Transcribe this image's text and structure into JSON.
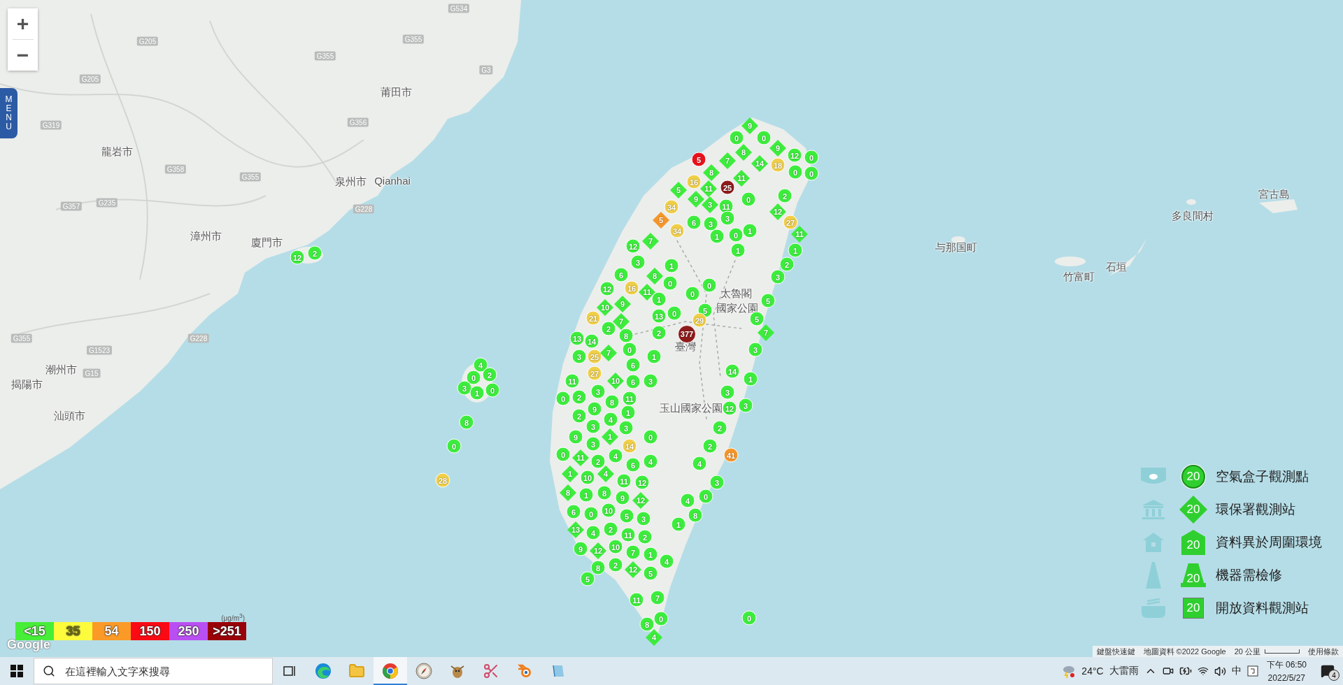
{
  "map_controls": {
    "zoom_in": "+",
    "zoom_out": "−"
  },
  "menu_tab": "MENU",
  "place_labels": [
    {
      "text": "莆田市"
    },
    {
      "text": "龍岩市"
    },
    {
      "text": "泉州市"
    },
    {
      "text": "漳州市"
    },
    {
      "text": "廈門市"
    },
    {
      "text": "潮州市"
    },
    {
      "text": "揭陽市"
    },
    {
      "text": "汕頭市"
    },
    {
      "text": "Qianhai"
    },
    {
      "text": "与那国町"
    },
    {
      "text": "多良間村"
    },
    {
      "text": "宮古島"
    },
    {
      "text": "竹富町"
    },
    {
      "text": "石垣"
    },
    {
      "text": "太魯閣"
    },
    {
      "text": "國家公園"
    },
    {
      "text": "玉山國家公園"
    },
    {
      "text": "臺灣"
    }
  ],
  "road_shields": [
    "G534",
    "G205",
    "G205",
    "G355",
    "G355",
    "G3",
    "G356",
    "G319",
    "G358",
    "G355",
    "G228",
    "G235",
    "G357",
    "G1523",
    "G15",
    "G228",
    "G355"
  ],
  "stations": [
    {
      "kind": "diamond",
      "value": "9",
      "color": "#3ded3d"
    },
    {
      "kind": "circle",
      "value": "0",
      "color": "#3ded3d"
    },
    {
      "kind": "circle",
      "value": "0",
      "color": "#3ded3d"
    },
    {
      "kind": "diamond",
      "value": "8",
      "color": "#3ded3d"
    },
    {
      "kind": "diamond",
      "value": "9",
      "color": "#3ded3d"
    },
    {
      "kind": "circle",
      "value": "12",
      "color": "#3ded3d"
    },
    {
      "kind": "circle",
      "value": "0",
      "color": "#3ded3d"
    },
    {
      "kind": "circle",
      "value": "0",
      "color": "#3ded3d"
    },
    {
      "kind": "circle",
      "value": "0",
      "color": "#3ded3d"
    },
    {
      "kind": "diamond",
      "value": "14",
      "color": "#3ded3d"
    },
    {
      "kind": "diamond",
      "value": "7",
      "color": "#3ded3d"
    },
    {
      "kind": "circle",
      "value": "18",
      "color": "#f0cf48"
    },
    {
      "kind": "circle",
      "value": "5",
      "color": "#e8121c"
    },
    {
      "kind": "diamond",
      "value": "8",
      "color": "#3ded3d"
    },
    {
      "kind": "diamond",
      "value": "11",
      "color": "#3ded3d"
    },
    {
      "kind": "diamond",
      "value": "11",
      "color": "#3ded3d"
    },
    {
      "kind": "circle",
      "value": "25",
      "color": "#8e1b1b"
    },
    {
      "kind": "circle",
      "value": "16",
      "color": "#f0cf48"
    },
    {
      "kind": "diamond",
      "value": "5",
      "color": "#3ded3d"
    },
    {
      "kind": "circle",
      "value": "34",
      "color": "#f0cf48"
    },
    {
      "kind": "diamond",
      "value": "9",
      "color": "#3ded3d"
    },
    {
      "kind": "diamond",
      "value": "3",
      "color": "#3ded3d"
    },
    {
      "kind": "circle",
      "value": "11",
      "color": "#3ded3d"
    },
    {
      "kind": "circle",
      "value": "0",
      "color": "#3ded3d"
    },
    {
      "kind": "diamond",
      "value": "5",
      "color": "#f5962a"
    },
    {
      "kind": "circle",
      "value": "34",
      "color": "#f0cf48"
    },
    {
      "kind": "circle",
      "value": "6",
      "color": "#3ded3d"
    },
    {
      "kind": "circle",
      "value": "3",
      "color": "#3ded3d"
    },
    {
      "kind": "circle",
      "value": "3",
      "color": "#3ded3d"
    },
    {
      "kind": "circle",
      "value": "1",
      "color": "#3ded3d"
    },
    {
      "kind": "circle",
      "value": "1",
      "color": "#3ded3d"
    },
    {
      "kind": "circle",
      "value": "2",
      "color": "#3ded3d"
    },
    {
      "kind": "diamond",
      "value": "12",
      "color": "#3ded3d"
    },
    {
      "kind": "circle",
      "value": "27",
      "color": "#f0cf48"
    },
    {
      "kind": "diamond",
      "value": "11",
      "color": "#3ded3d"
    },
    {
      "kind": "circle",
      "value": "1",
      "color": "#3ded3d"
    },
    {
      "kind": "circle",
      "value": "2",
      "color": "#3ded3d"
    },
    {
      "kind": "circle",
      "value": "3",
      "color": "#3ded3d"
    },
    {
      "kind": "circle",
      "value": "0",
      "color": "#3ded3d"
    },
    {
      "kind": "circle",
      "value": "1",
      "color": "#3ded3d"
    },
    {
      "kind": "diamond",
      "value": "7",
      "color": "#3ded3d"
    },
    {
      "kind": "circle",
      "value": "12",
      "color": "#3ded3d"
    },
    {
      "kind": "circle",
      "value": "3",
      "color": "#3ded3d"
    },
    {
      "kind": "diamond",
      "value": "8",
      "color": "#3ded3d"
    },
    {
      "kind": "circle",
      "value": "1",
      "color": "#3ded3d"
    },
    {
      "kind": "circle",
      "value": "0",
      "color": "#3ded3d"
    },
    {
      "kind": "circle",
      "value": "6",
      "color": "#3ded3d"
    },
    {
      "kind": "circle",
      "value": "16",
      "color": "#f0cf48"
    },
    {
      "kind": "diamond",
      "value": "11",
      "color": "#3ded3d"
    },
    {
      "kind": "circle",
      "value": "12",
      "color": "#3ded3d"
    },
    {
      "kind": "diamond",
      "value": "9",
      "color": "#3ded3d"
    },
    {
      "kind": "diamond",
      "value": "10",
      "color": "#3ded3d"
    },
    {
      "kind": "diamond",
      "value": "7",
      "color": "#3ded3d"
    },
    {
      "kind": "circle",
      "value": "21",
      "color": "#f0cf48"
    },
    {
      "kind": "circle",
      "value": "2",
      "color": "#3ded3d"
    },
    {
      "kind": "circle",
      "value": "8",
      "color": "#3ded3d"
    },
    {
      "kind": "circle",
      "value": "1",
      "color": "#3ded3d"
    },
    {
      "kind": "circle",
      "value": "13",
      "color": "#3ded3d"
    },
    {
      "kind": "circle",
      "value": "2",
      "color": "#3ded3d"
    },
    {
      "kind": "circle",
      "value": "0",
      "color": "#3ded3d"
    },
    {
      "kind": "circle",
      "value": "0",
      "color": "#3ded3d"
    },
    {
      "kind": "circle",
      "value": "0",
      "color": "#3ded3d"
    },
    {
      "kind": "circle",
      "value": "5",
      "color": "#3ded3d"
    },
    {
      "kind": "circle",
      "value": "377",
      "color": "#8e1b1b"
    },
    {
      "kind": "circle",
      "value": "29",
      "color": "#f0cf48"
    },
    {
      "kind": "circle",
      "value": "5",
      "color": "#3ded3d"
    },
    {
      "kind": "circle",
      "value": "5",
      "color": "#3ded3d"
    },
    {
      "kind": "diamond",
      "value": "7",
      "color": "#3ded3d"
    },
    {
      "kind": "circle",
      "value": "3",
      "color": "#3ded3d"
    },
    {
      "kind": "circle",
      "value": "13",
      "color": "#3ded3d"
    },
    {
      "kind": "circle",
      "value": "14",
      "color": "#3ded3d"
    },
    {
      "kind": "circle",
      "value": "25",
      "color": "#f0cf48"
    },
    {
      "kind": "diamond",
      "value": "7",
      "color": "#3ded3d"
    },
    {
      "kind": "circle",
      "value": "3",
      "color": "#3ded3d"
    },
    {
      "kind": "circle",
      "value": "0",
      "color": "#3ded3d"
    },
    {
      "kind": "circle",
      "value": "6",
      "color": "#3ded3d"
    },
    {
      "kind": "circle",
      "value": "1",
      "color": "#3ded3d"
    },
    {
      "kind": "diamond",
      "value": "10",
      "color": "#3ded3d"
    },
    {
      "kind": "circle",
      "value": "6",
      "color": "#3ded3d"
    },
    {
      "kind": "circle",
      "value": "3",
      "color": "#3ded3d"
    },
    {
      "kind": "circle",
      "value": "27",
      "color": "#f0cf48"
    },
    {
      "kind": "circle",
      "value": "11",
      "color": "#3ded3d"
    },
    {
      "kind": "circle",
      "value": "2",
      "color": "#3ded3d"
    },
    {
      "kind": "circle",
      "value": "3",
      "color": "#3ded3d"
    },
    {
      "kind": "circle",
      "value": "0",
      "color": "#3ded3d"
    },
    {
      "kind": "circle",
      "value": "9",
      "color": "#3ded3d"
    },
    {
      "kind": "circle",
      "value": "8",
      "color": "#3ded3d"
    },
    {
      "kind": "circle",
      "value": "1",
      "color": "#3ded3d"
    },
    {
      "kind": "circle",
      "value": "4",
      "color": "#3ded3d"
    },
    {
      "kind": "circle",
      "value": "2",
      "color": "#3ded3d"
    },
    {
      "kind": "circle",
      "value": "11",
      "color": "#3ded3d"
    },
    {
      "kind": "circle",
      "value": "3",
      "color": "#3ded3d"
    },
    {
      "kind": "circle",
      "value": "9",
      "color": "#3ded3d"
    },
    {
      "kind": "circle",
      "value": "3",
      "color": "#3ded3d"
    },
    {
      "kind": "diamond",
      "value": "1",
      "color": "#3ded3d"
    },
    {
      "kind": "circle",
      "value": "3",
      "color": "#3ded3d"
    },
    {
      "kind": "circle",
      "value": "14",
      "color": "#f0cf48"
    },
    {
      "kind": "circle",
      "value": "0",
      "color": "#3ded3d"
    },
    {
      "kind": "circle",
      "value": "0",
      "color": "#3ded3d"
    },
    {
      "kind": "diamond",
      "value": "11",
      "color": "#3ded3d"
    },
    {
      "kind": "circle",
      "value": "2",
      "color": "#3ded3d"
    },
    {
      "kind": "circle",
      "value": "4",
      "color": "#3ded3d"
    },
    {
      "kind": "circle",
      "value": "6",
      "color": "#3ded3d"
    },
    {
      "kind": "circle",
      "value": "4",
      "color": "#3ded3d"
    },
    {
      "kind": "diamond",
      "value": "1",
      "color": "#3ded3d"
    },
    {
      "kind": "circle",
      "value": "10",
      "color": "#3ded3d"
    },
    {
      "kind": "diamond",
      "value": "4",
      "color": "#3ded3d"
    },
    {
      "kind": "circle",
      "value": "11",
      "color": "#3ded3d"
    },
    {
      "kind": "circle",
      "value": "12",
      "color": "#3ded3d"
    },
    {
      "kind": "diamond",
      "value": "8",
      "color": "#3ded3d"
    },
    {
      "kind": "circle",
      "value": "1",
      "color": "#3ded3d"
    },
    {
      "kind": "circle",
      "value": "8",
      "color": "#3ded3d"
    },
    {
      "kind": "circle",
      "value": "9",
      "color": "#3ded3d"
    },
    {
      "kind": "diamond",
      "value": "12",
      "color": "#3ded3d"
    },
    {
      "kind": "circle",
      "value": "6",
      "color": "#3ded3d"
    },
    {
      "kind": "circle",
      "value": "0",
      "color": "#3ded3d"
    },
    {
      "kind": "circle",
      "value": "10",
      "color": "#3ded3d"
    },
    {
      "kind": "circle",
      "value": "5",
      "color": "#3ded3d"
    },
    {
      "kind": "circle",
      "value": "3",
      "color": "#3ded3d"
    },
    {
      "kind": "diamond",
      "value": "13",
      "color": "#3ded3d"
    },
    {
      "kind": "circle",
      "value": "4",
      "color": "#3ded3d"
    },
    {
      "kind": "circle",
      "value": "2",
      "color": "#3ded3d"
    },
    {
      "kind": "circle",
      "value": "11",
      "color": "#3ded3d"
    },
    {
      "kind": "circle",
      "value": "2",
      "color": "#3ded3d"
    },
    {
      "kind": "circle",
      "value": "9",
      "color": "#3ded3d"
    },
    {
      "kind": "diamond",
      "value": "12",
      "color": "#3ded3d"
    },
    {
      "kind": "circle",
      "value": "10",
      "color": "#3ded3d"
    },
    {
      "kind": "circle",
      "value": "7",
      "color": "#3ded3d"
    },
    {
      "kind": "circle",
      "value": "1",
      "color": "#3ded3d"
    },
    {
      "kind": "circle",
      "value": "8",
      "color": "#3ded3d"
    },
    {
      "kind": "circle",
      "value": "2",
      "color": "#3ded3d"
    },
    {
      "kind": "diamond",
      "value": "12",
      "color": "#3ded3d"
    },
    {
      "kind": "circle",
      "value": "5",
      "color": "#3ded3d"
    },
    {
      "kind": "circle",
      "value": "4",
      "color": "#3ded3d"
    },
    {
      "kind": "circle",
      "value": "7",
      "color": "#3ded3d"
    },
    {
      "kind": "circle",
      "value": "11",
      "color": "#3ded3d"
    },
    {
      "kind": "circle",
      "value": "0",
      "color": "#3ded3d"
    },
    {
      "kind": "circle",
      "value": "8",
      "color": "#3ded3d"
    },
    {
      "kind": "diamond",
      "value": "4",
      "color": "#3ded3d"
    },
    {
      "kind": "circle",
      "value": "5",
      "color": "#3ded3d"
    },
    {
      "kind": "circle",
      "value": "14",
      "color": "#3ded3d"
    },
    {
      "kind": "circle",
      "value": "1",
      "color": "#3ded3d"
    },
    {
      "kind": "circle",
      "value": "3",
      "color": "#3ded3d"
    },
    {
      "kind": "circle",
      "value": "12",
      "color": "#3ded3d"
    },
    {
      "kind": "circle",
      "value": "3",
      "color": "#3ded3d"
    },
    {
      "kind": "circle",
      "value": "2",
      "color": "#3ded3d"
    },
    {
      "kind": "circle",
      "value": "2",
      "color": "#3ded3d"
    },
    {
      "kind": "circle",
      "value": "41",
      "color": "#f5962a"
    },
    {
      "kind": "circle",
      "value": "4",
      "color": "#3ded3d"
    },
    {
      "kind": "circle",
      "value": "3",
      "color": "#3ded3d"
    },
    {
      "kind": "circle",
      "value": "0",
      "color": "#3ded3d"
    },
    {
      "kind": "circle",
      "value": "4",
      "color": "#3ded3d"
    },
    {
      "kind": "circle",
      "value": "8",
      "color": "#3ded3d"
    },
    {
      "kind": "circle",
      "value": "1",
      "color": "#3ded3d"
    },
    {
      "kind": "circle",
      "value": "12",
      "color": "#3ded3d"
    },
    {
      "kind": "circle",
      "value": "2",
      "color": "#3ded3d"
    },
    {
      "kind": "circle",
      "value": "4",
      "color": "#3ded3d"
    },
    {
      "kind": "circle",
      "value": "0",
      "color": "#3ded3d"
    },
    {
      "kind": "circle",
      "value": "2",
      "color": "#3ded3d"
    },
    {
      "kind": "circle",
      "value": "3",
      "color": "#3ded3d"
    },
    {
      "kind": "circle",
      "value": "1",
      "color": "#3ded3d"
    },
    {
      "kind": "circle",
      "value": "0",
      "color": "#3ded3d"
    },
    {
      "kind": "circle",
      "value": "8",
      "color": "#3ded3d"
    },
    {
      "kind": "circle",
      "value": "0",
      "color": "#3ded3d"
    },
    {
      "kind": "circle",
      "value": "28",
      "color": "#f0cf48"
    },
    {
      "kind": "circle",
      "value": "0",
      "color": "#3ded3d"
    }
  ],
  "pm25_scale": {
    "unit": "(μg/m$^{3}$)",
    "bins": [
      {
        "label": "<15",
        "color": "#47ee38"
      },
      {
        "label": "35",
        "color": "#fdfc3c"
      },
      {
        "label": "54",
        "color": "#fb9a27"
      },
      {
        "label": "150",
        "color": "#fa0a14"
      },
      {
        "label": "250",
        "color": "#b94ff2"
      },
      {
        "label": ">251",
        "color": "#990008"
      }
    ]
  },
  "legend": [
    {
      "kind": "airbox",
      "marker_value": "20",
      "label": "空氣盒子觀測點"
    },
    {
      "kind": "epa",
      "marker_value": "20",
      "label": "環保署觀測站"
    },
    {
      "kind": "anomaly",
      "marker_value": "20",
      "label": "資料異於周圍環境"
    },
    {
      "kind": "repair",
      "marker_value": "20",
      "label": "機器需檢修"
    },
    {
      "kind": "open_data",
      "marker_value": "20",
      "label": "開放資料觀測站"
    }
  ],
  "google_logo": "Google",
  "attribution": {
    "shortcuts": "鍵盤快速鍵",
    "map_data": "地圖資料 ©2022 Google",
    "scale": "20 公里",
    "terms": "使用條款"
  },
  "taskbar": {
    "search": {
      "placeholder": "在這裡輸入文字來搜尋"
    },
    "apps": [
      {
        "kind": "edge",
        "selected": false
      },
      {
        "kind": "folder",
        "selected": false
      },
      {
        "kind": "chrome",
        "selected": true
      },
      {
        "kind": "compass",
        "selected": false
      },
      {
        "kind": "bird",
        "selected": false
      },
      {
        "kind": "scissors",
        "selected": false
      },
      {
        "kind": "blender",
        "selected": false
      },
      {
        "kind": "notepad",
        "selected": false
      }
    ],
    "weather": {
      "temperature": "24°C",
      "condition": "大雷雨"
    },
    "ime": "中",
    "time": "下午 06:50",
    "date": "2022/5/27",
    "notifications": "4"
  }
}
